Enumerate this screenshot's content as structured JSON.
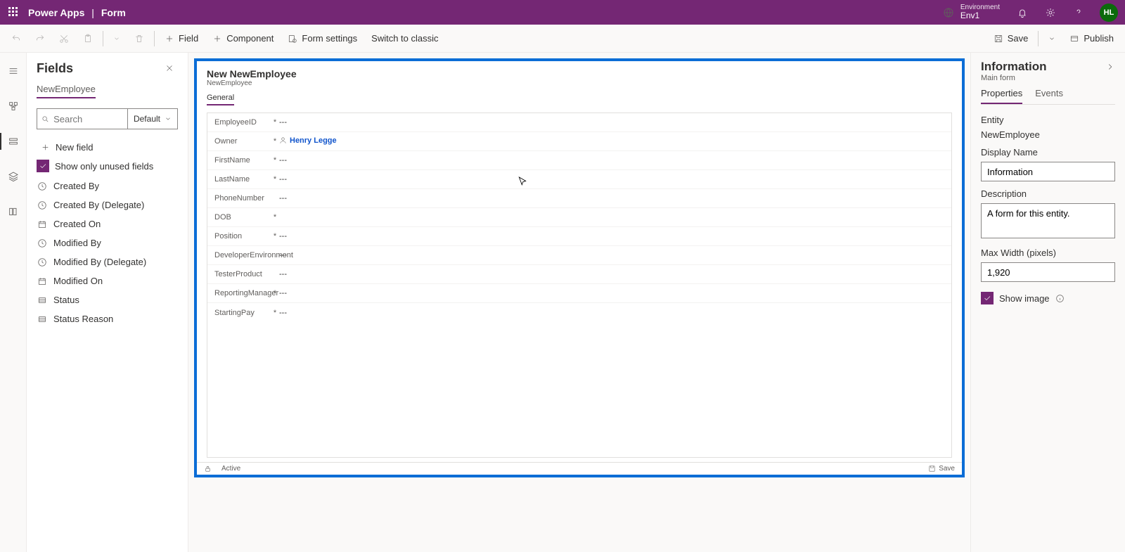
{
  "header": {
    "app": "Power Apps",
    "page": "Form",
    "env_label": "Environment",
    "env_name": "Env1",
    "avatar": "HL"
  },
  "cmdbar": {
    "field": "Field",
    "component": "Component",
    "form_settings": "Form settings",
    "switch_classic": "Switch to classic",
    "save": "Save",
    "publish": "Publish"
  },
  "fields_panel": {
    "title": "Fields",
    "entity": "NewEmployee",
    "search_ph": "Search",
    "filter": "Default",
    "new_field": "New field",
    "show_unused": "Show only unused fields",
    "items": [
      {
        "label": "Created By",
        "icon": "clock"
      },
      {
        "label": "Created By (Delegate)",
        "icon": "clock"
      },
      {
        "label": "Created On",
        "icon": "calendar"
      },
      {
        "label": "Modified By",
        "icon": "clock"
      },
      {
        "label": "Modified By (Delegate)",
        "icon": "clock"
      },
      {
        "label": "Modified On",
        "icon": "calendar"
      },
      {
        "label": "Status",
        "icon": "list"
      },
      {
        "label": "Status Reason",
        "icon": "list"
      }
    ]
  },
  "canvas": {
    "title": "New NewEmployee",
    "subtitle": "NewEmployee",
    "tab": "General",
    "footer_status": "Active",
    "footer_save": "Save",
    "owner_value": "Henry Legge",
    "rows": [
      {
        "label": "EmployeeID",
        "required": true,
        "value": "---"
      },
      {
        "label": "Owner",
        "required": true,
        "owner": true
      },
      {
        "label": "FirstName",
        "required": true,
        "value": "---"
      },
      {
        "label": "LastName",
        "required": true,
        "value": "---"
      },
      {
        "label": "PhoneNumber",
        "required": false,
        "value": "---"
      },
      {
        "label": "DOB",
        "required": true,
        "value": ""
      },
      {
        "label": "Position",
        "required": true,
        "value": "---"
      },
      {
        "label": "DeveloperEnvironment",
        "required": false,
        "value": "---"
      },
      {
        "label": "TesterProduct",
        "required": false,
        "value": "---"
      },
      {
        "label": "ReportingManager",
        "required": true,
        "value": "---"
      },
      {
        "label": "StartingPay",
        "required": true,
        "value": "---"
      }
    ]
  },
  "right": {
    "title": "Information",
    "subtitle": "Main form",
    "tab_properties": "Properties",
    "tab_events": "Events",
    "entity_label": "Entity",
    "entity_value": "NewEmployee",
    "display_name_label": "Display Name",
    "display_name_value": "Information",
    "description_label": "Description",
    "description_value": "A form for this entity.",
    "maxwidth_label": "Max Width (pixels)",
    "maxwidth_value": "1,920",
    "show_image": "Show image"
  }
}
